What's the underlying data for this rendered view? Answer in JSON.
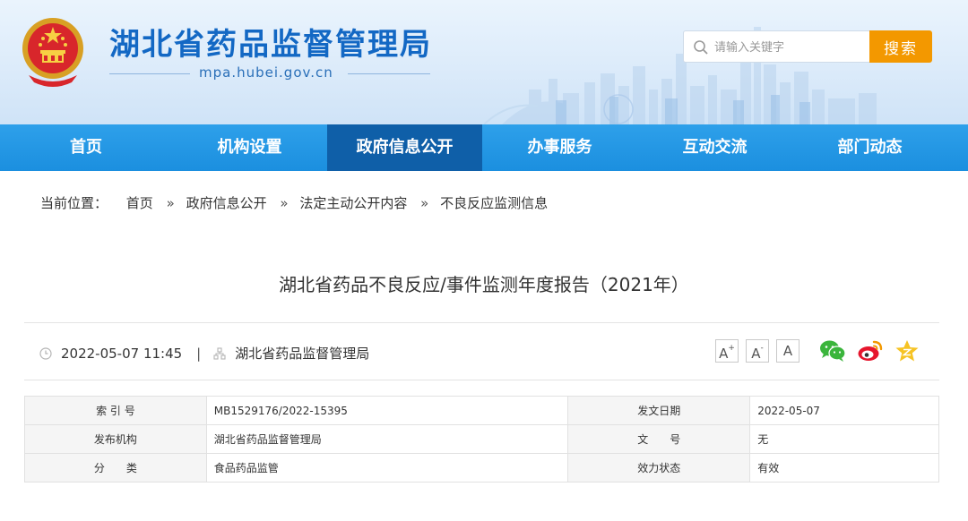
{
  "header": {
    "site_title": "湖北省药品监督管理局",
    "site_url": "mpa.hubei.gov.cn",
    "search_placeholder": "请输入关键字",
    "search_button": "搜索"
  },
  "nav": {
    "items": [
      {
        "label": "首页",
        "active": false
      },
      {
        "label": "机构设置",
        "active": false
      },
      {
        "label": "政府信息公开",
        "active": true
      },
      {
        "label": "办事服务",
        "active": false
      },
      {
        "label": "互动交流",
        "active": false
      },
      {
        "label": "部门动态",
        "active": false
      }
    ]
  },
  "breadcrumb": {
    "prefix": "当前位置：",
    "items": [
      "首页",
      "政府信息公开",
      "法定主动公开内容",
      "不良反应监测信息"
    ],
    "separator": "»"
  },
  "article": {
    "title": "湖北省药品不良反应/事件监测年度报告（2021年）",
    "datetime": "2022-05-07 11:45",
    "divider": "|",
    "source": "湖北省药品监督管理局",
    "font_controls": [
      "A+",
      "A",
      "A"
    ],
    "share_icons": [
      "wechat-icon",
      "weibo-icon",
      "qzone-icon"
    ]
  },
  "info_table": {
    "rows": [
      {
        "label1": "索 引 号",
        "value1": "MB1529176/2022-15395",
        "label2": "发文日期",
        "value2": "2022-05-07"
      },
      {
        "label1": "发布机构",
        "value1": "湖北省药品监督管理局",
        "label2": "文　　号",
        "value2": "无"
      },
      {
        "label1": "分　　类",
        "value1": "食品药品监管",
        "label2": "效力状态",
        "value2": "有效"
      }
    ]
  },
  "colors": {
    "brand_blue": "#1368c4",
    "nav_blue": "#1b8fdf",
    "nav_active": "#0f5fa8",
    "search_orange": "#f39800"
  }
}
